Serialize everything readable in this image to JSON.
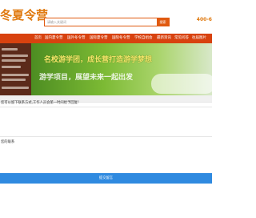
{
  "site": {
    "logo": "冬夏令营",
    "search_placeholder": "请输入关键词",
    "search_button": "搜索",
    "hotline": "400-6",
    "nav": [
      "首页",
      "国内夏令营",
      "国外冬令营",
      "国际夏令营",
      "国际冬令营",
      "学校自组会",
      "最新资讯",
      "常见问答",
      "往届图片"
    ]
  },
  "banner": {
    "line1": "名校游学团，成长营打造游学梦想",
    "line2": "游学项目，展望未来一起出发"
  },
  "dialog": {
    "message": "您可以留下联系方式,工作人员会第一时间给予回复！",
    "form_label": "您的联系",
    "submit_label": "提交留言"
  },
  "colors": {
    "nav": "#d8420f",
    "logo": "#e07a10",
    "submit": "#2f8ae0",
    "sidebar": "#5c2a1a"
  }
}
